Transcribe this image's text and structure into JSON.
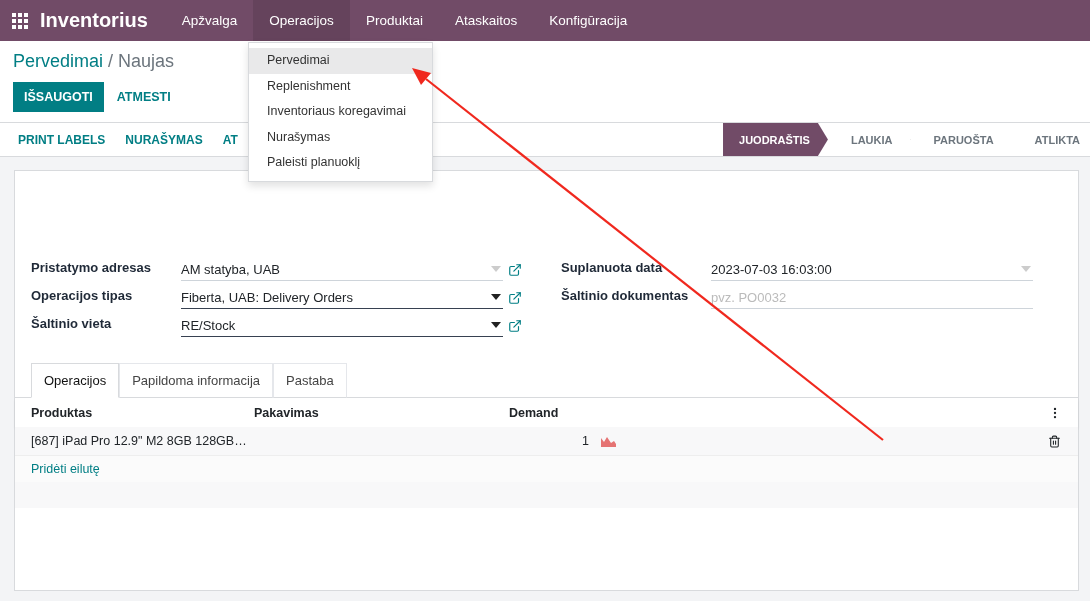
{
  "navbar": {
    "app_name": "Inventorius",
    "menus": [
      {
        "label": "Apžvalga",
        "selected": false
      },
      {
        "label": "Operacijos",
        "selected": true
      },
      {
        "label": "Produktai",
        "selected": false
      },
      {
        "label": "Ataskaitos",
        "selected": false
      },
      {
        "label": "Konfigūracija",
        "selected": false
      }
    ]
  },
  "dropdown": {
    "items": [
      {
        "label": "Pervedimai",
        "selected": true
      },
      {
        "label": "Replenishment",
        "selected": false
      },
      {
        "label": "Inventoriaus koregavimai",
        "selected": false
      },
      {
        "label": "Nurašymas",
        "selected": false
      },
      {
        "label": "Paleisti planuoklį",
        "selected": false
      }
    ]
  },
  "breadcrumb": {
    "parent": "Pervedimai",
    "separator": "/",
    "current": "Naujas"
  },
  "buttons": [
    {
      "label": "IŠSAUGOTI",
      "kind": "primary"
    },
    {
      "label": "ATMESTI",
      "kind": "secondary"
    }
  ],
  "actions": [
    "PRINT LABELS",
    "NURAŠYMAS",
    "AT"
  ],
  "stages": [
    {
      "label": "JUODRAŠTIS",
      "selected": true
    },
    {
      "label": "LAUKIA",
      "selected": false
    },
    {
      "label": "PARUOŠTA",
      "selected": false
    },
    {
      "label": "ATLIKTA",
      "selected": false
    }
  ],
  "left_fields": [
    {
      "label": "Pristatymo adresas",
      "kind": "select",
      "value": "AM statyba, UAB",
      "required": false
    },
    {
      "label": "Operacijos tipas",
      "kind": "select",
      "value": "Fiberta, UAB: Delivery Orders",
      "required": true
    },
    {
      "label": "Šaltinio vieta",
      "kind": "select",
      "value": "RE/Stock",
      "required": true
    }
  ],
  "right_fields": [
    {
      "label": "Suplanuota data",
      "kind": "date",
      "value": "2023-07-03 16:03:00",
      "required": false
    },
    {
      "label": "Šaltinio dokumentas",
      "kind": "text",
      "placeholder": "pvz. PO0032",
      "required": false
    }
  ],
  "tabs": [
    {
      "label": "Operacijos",
      "selected": true
    },
    {
      "label": "Papildoma informacija",
      "selected": false
    },
    {
      "label": "Pastaba",
      "selected": false
    }
  ],
  "table": {
    "columns": [
      "Produktas",
      "Pakavimas",
      "Demand"
    ],
    "rows": [
      {
        "product": "[687] iPad Pro 12.9\" M2 8GB 128GB…",
        "packaging": "",
        "demand": "1"
      }
    ],
    "add_line": "Pridėti eilutę"
  }
}
